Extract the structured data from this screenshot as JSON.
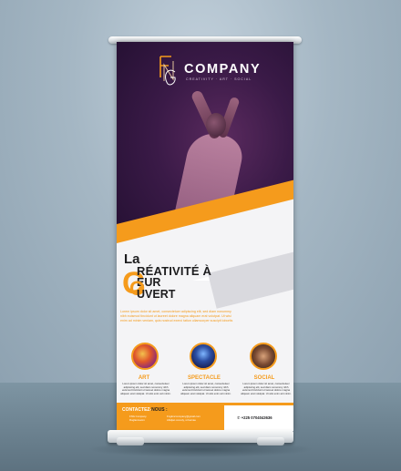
{
  "brand": {
    "name": "COMPANY",
    "tagline": "CREATIVITY · ART · SOCIAL"
  },
  "headline": {
    "la": "La",
    "line1": "RÉATIVITÉ À",
    "line2": "EUR",
    "line3": "UVERT",
    "big_c": "C",
    "big_o": "O"
  },
  "intro": [
    "Lorem ipsum dolor sit amet, consectetuer adipiscing elit, sed diam nonummy",
    "nibh euismod tincidunt ut laoreet dolore magna aliquam erat volutpat. Ut wisi",
    "enim ad minim veniam, quis nostrud exerci tation ullamcorper suscipit lobortis"
  ],
  "categories": [
    {
      "label": "ART",
      "text": "Lorem ipsum dolor sit amet, consectetuer adipiscing elit, sed diam nonummy nibh euismod tincidunt ut laoreet dolore magna aliquam erat volutpat. Ut wisi enim ad minim."
    },
    {
      "label": "SPECTACLE",
      "text": "Lorem ipsum dolor sit amet, consectetuer adipiscing elit, sed diam nonummy nibh euismod tincidunt ut laoreet dolore magna aliquam erat volutpat. Ut wisi enim ad minim."
    },
    {
      "label": "SOCIAL",
      "text": "Lorem ipsum dolor sit amet, consectetuer adipiscing elit, sed diam nonummy nibh euismod tincidunt ut laoreet dolore magna aliquam erat volutpat. Ut wisi enim ad minim."
    }
  ],
  "footer": {
    "title": "CONTACTEZ-",
    "title_accent": "NOUS :",
    "col1": [
      "FNG Company",
      "Ruglanmanrn"
    ],
    "col2": [
      "Fngkmccompany@gmail.com",
      "Abidjan cocody, st bernée"
    ],
    "phone": "+225 0704043636"
  },
  "colors": {
    "accent": "#f59b1c",
    "photo_dark": "#2a1236"
  }
}
